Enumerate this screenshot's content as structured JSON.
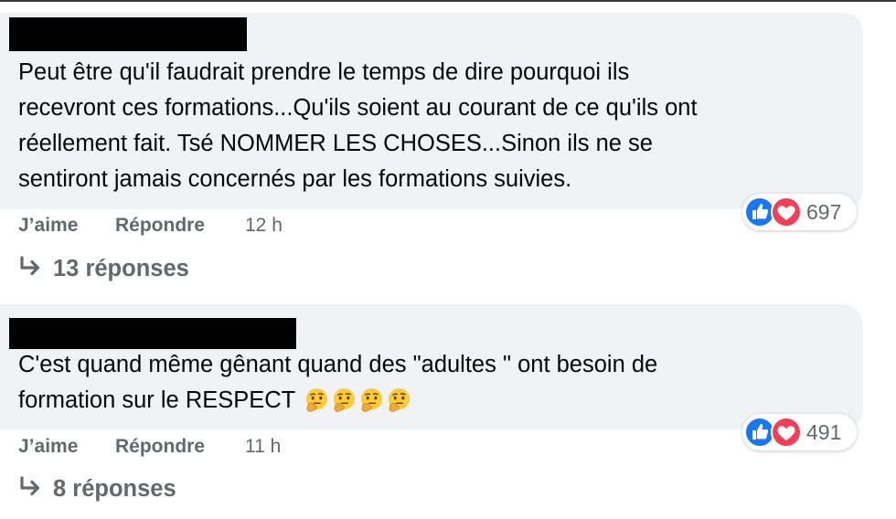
{
  "comments": [
    {
      "text_lines": [
        "Peut être qu'il faudrait prendre le temps de dire pourquoi ils",
        "recevront ces formations...Qu'ils soient au courant de ce qu'ils ont",
        "réellement fait. Tsé NOMMER LES CHOSES...Sinon ils ne se",
        "sentiront jamais concernés par les formations suivies."
      ],
      "like_label": "J’aime",
      "reply_label": "Répondre",
      "time": "12 h",
      "reaction_count": "697",
      "reactions": [
        "like-icon",
        "love-icon"
      ],
      "replies_label": "13 réponses"
    },
    {
      "text_lines": [
        "C'est quand même gênant quand des \"adultes \" ont besoin de",
        "formation sur le RESPECT"
      ],
      "emojis": [
        "thinking-face-emoji",
        "thinking-face-emoji",
        "thinking-face-emoji",
        "thinking-face-emoji"
      ],
      "like_label": "J’aime",
      "reply_label": "Répondre",
      "time": "11 h",
      "reaction_count": "491",
      "reactions": [
        "like-icon",
        "love-icon"
      ],
      "replies_label": "8 réponses"
    }
  ],
  "colors": {
    "bubble": "#f0f2f5",
    "secondary_text": "#65676b",
    "like_blue": "#1877f2",
    "love_red": "#f33e58",
    "redaction": "#000000"
  }
}
